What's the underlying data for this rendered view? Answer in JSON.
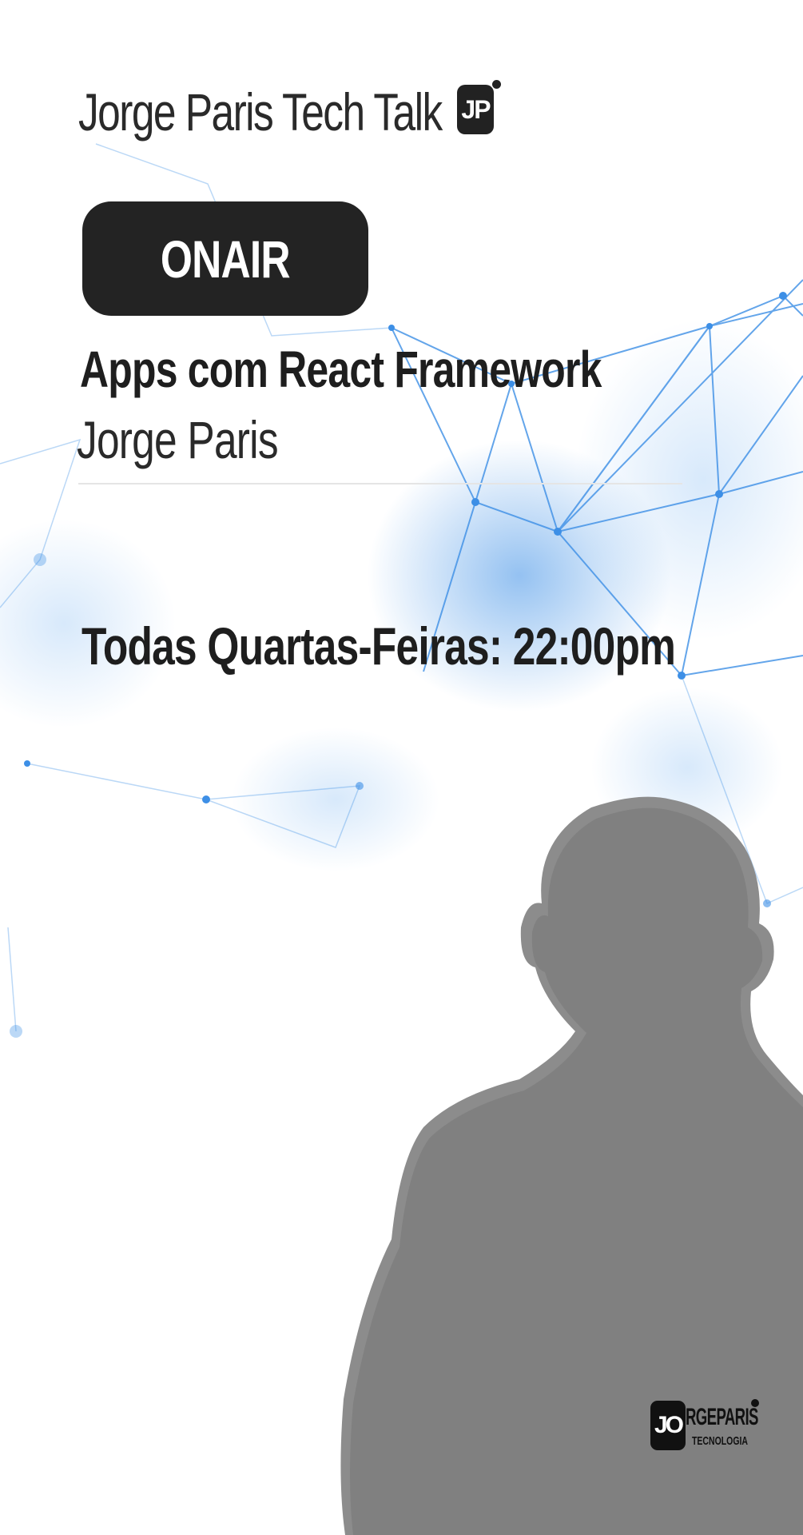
{
  "header": {
    "brand_title": "Jorge Paris Tech Talk",
    "brand_logo": "JP"
  },
  "badge": {
    "label": "ONAIR"
  },
  "talk": {
    "title": "Apps com React Framework",
    "speaker": "Jorge Paris"
  },
  "schedule": {
    "text": "Todas Quartas-Feiras: 22:00pm"
  },
  "footer": {
    "logo_mark": "JO",
    "logo_name": "RGEPARIS",
    "logo_sub": "TECNOLOGIA"
  },
  "colors": {
    "accent": "#3d8fe6",
    "dark": "#232323",
    "silhouette": "#808080"
  },
  "icons": {
    "brand_logo": "jp-logo-icon",
    "footer_logo": "jorgeparis-logo-icon"
  }
}
